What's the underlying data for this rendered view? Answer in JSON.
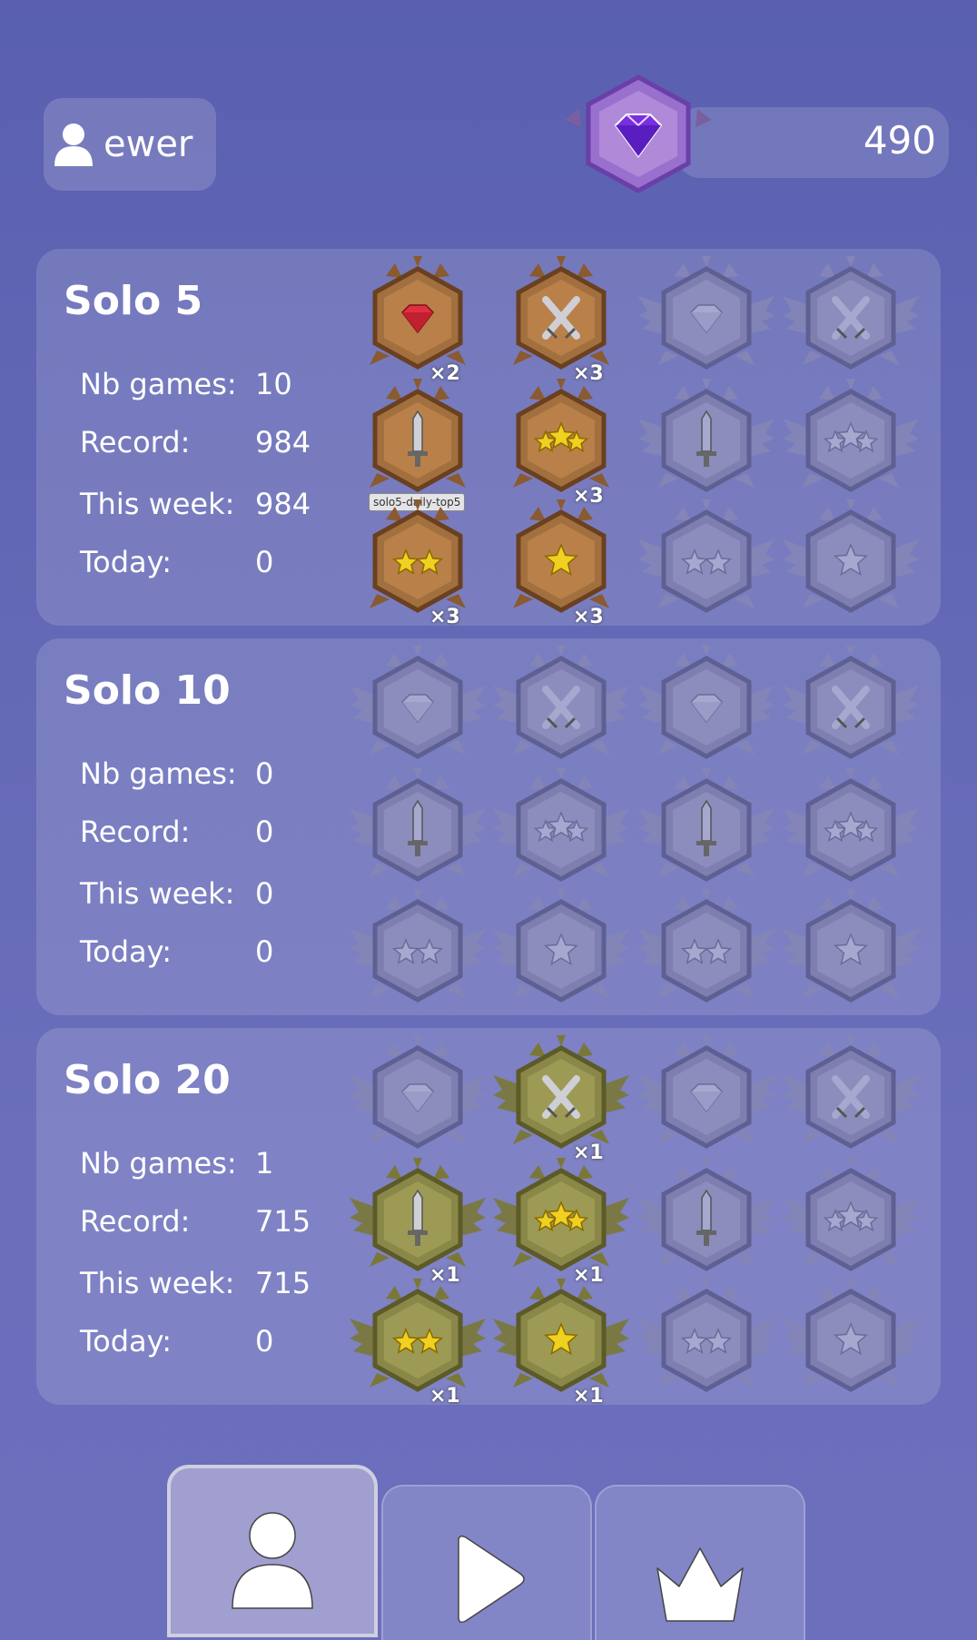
{
  "user": {
    "name": "ewer",
    "icon": "user-icon"
  },
  "gems": {
    "count": "490",
    "icon": "purple-gem-icon"
  },
  "tooltip": "solo5-daily-top5",
  "labels": {
    "nb_games": "Nb games:",
    "record": "Record:",
    "this_week": "This week:",
    "today": "Today:"
  },
  "sections": [
    {
      "title": "Solo 5",
      "stats": {
        "nb_games": "10",
        "record": "984",
        "this_week": "984",
        "today": "0"
      },
      "medals": [
        {
          "icon": "gem-medal-icon",
          "tier": "bronze",
          "count": "×2"
        },
        {
          "icon": "swords-medal-icon",
          "tier": "bronze",
          "count": "×3"
        },
        {
          "icon": "gem-medal-icon",
          "tier": "locked",
          "count": ""
        },
        {
          "icon": "swords-medal-icon",
          "tier": "locked",
          "count": ""
        },
        {
          "icon": "sword-medal-icon",
          "tier": "bronze",
          "count": ""
        },
        {
          "icon": "three-stars-medal-icon",
          "tier": "bronze",
          "count": "×3"
        },
        {
          "icon": "sword-medal-icon",
          "tier": "locked",
          "count": ""
        },
        {
          "icon": "three-stars-medal-icon",
          "tier": "locked",
          "count": ""
        },
        {
          "icon": "two-stars-medal-icon",
          "tier": "bronze",
          "count": "×3"
        },
        {
          "icon": "one-star-medal-icon",
          "tier": "bronze",
          "count": "×3"
        },
        {
          "icon": "two-stars-medal-icon",
          "tier": "locked",
          "count": ""
        },
        {
          "icon": "one-star-medal-icon",
          "tier": "locked",
          "count": ""
        }
      ]
    },
    {
      "title": "Solo 10",
      "stats": {
        "nb_games": "0",
        "record": "0",
        "this_week": "0",
        "today": "0"
      },
      "medals": [
        {
          "icon": "gem-medal-icon",
          "tier": "locked",
          "count": ""
        },
        {
          "icon": "swords-medal-icon",
          "tier": "locked",
          "count": ""
        },
        {
          "icon": "gem-medal-icon",
          "tier": "locked",
          "count": ""
        },
        {
          "icon": "swords-medal-icon",
          "tier": "locked",
          "count": ""
        },
        {
          "icon": "sword-medal-icon",
          "tier": "locked",
          "count": ""
        },
        {
          "icon": "three-stars-medal-icon",
          "tier": "locked",
          "count": ""
        },
        {
          "icon": "sword-medal-icon",
          "tier": "locked",
          "count": ""
        },
        {
          "icon": "three-stars-medal-icon",
          "tier": "locked",
          "count": ""
        },
        {
          "icon": "two-stars-medal-icon",
          "tier": "locked",
          "count": ""
        },
        {
          "icon": "one-star-medal-icon",
          "tier": "locked",
          "count": ""
        },
        {
          "icon": "two-stars-medal-icon",
          "tier": "locked",
          "count": ""
        },
        {
          "icon": "one-star-medal-icon",
          "tier": "locked",
          "count": ""
        }
      ]
    },
    {
      "title": "Solo 20",
      "stats": {
        "nb_games": "1",
        "record": "715",
        "this_week": "715",
        "today": "0"
      },
      "medals": [
        {
          "icon": "gem-medal-icon",
          "tier": "locked",
          "count": ""
        },
        {
          "icon": "swords-medal-icon",
          "tier": "olive",
          "count": "×1"
        },
        {
          "icon": "gem-medal-icon",
          "tier": "locked",
          "count": ""
        },
        {
          "icon": "swords-medal-icon",
          "tier": "locked",
          "count": ""
        },
        {
          "icon": "sword-medal-icon",
          "tier": "olive",
          "count": "×1"
        },
        {
          "icon": "three-stars-medal-icon",
          "tier": "olive",
          "count": "×1"
        },
        {
          "icon": "sword-medal-icon",
          "tier": "locked",
          "count": ""
        },
        {
          "icon": "three-stars-medal-icon",
          "tier": "locked",
          "count": ""
        },
        {
          "icon": "two-stars-medal-icon",
          "tier": "olive",
          "count": "×1"
        },
        {
          "icon": "one-star-medal-icon",
          "tier": "olive",
          "count": "×1"
        },
        {
          "icon": "two-stars-medal-icon",
          "tier": "locked",
          "count": ""
        },
        {
          "icon": "one-star-medal-icon",
          "tier": "locked",
          "count": ""
        }
      ]
    }
  ],
  "tabs": [
    {
      "icon": "profile-icon",
      "active": true
    },
    {
      "icon": "play-icon",
      "active": false
    },
    {
      "icon": "crown-icon",
      "active": false
    }
  ],
  "colors": {
    "bronze": "#9a6a3c",
    "olive": "#8a8848",
    "locked": "#7e7fb0",
    "ruby": "#e03040",
    "star": "#f0d020",
    "accent": "#8a55d0"
  }
}
